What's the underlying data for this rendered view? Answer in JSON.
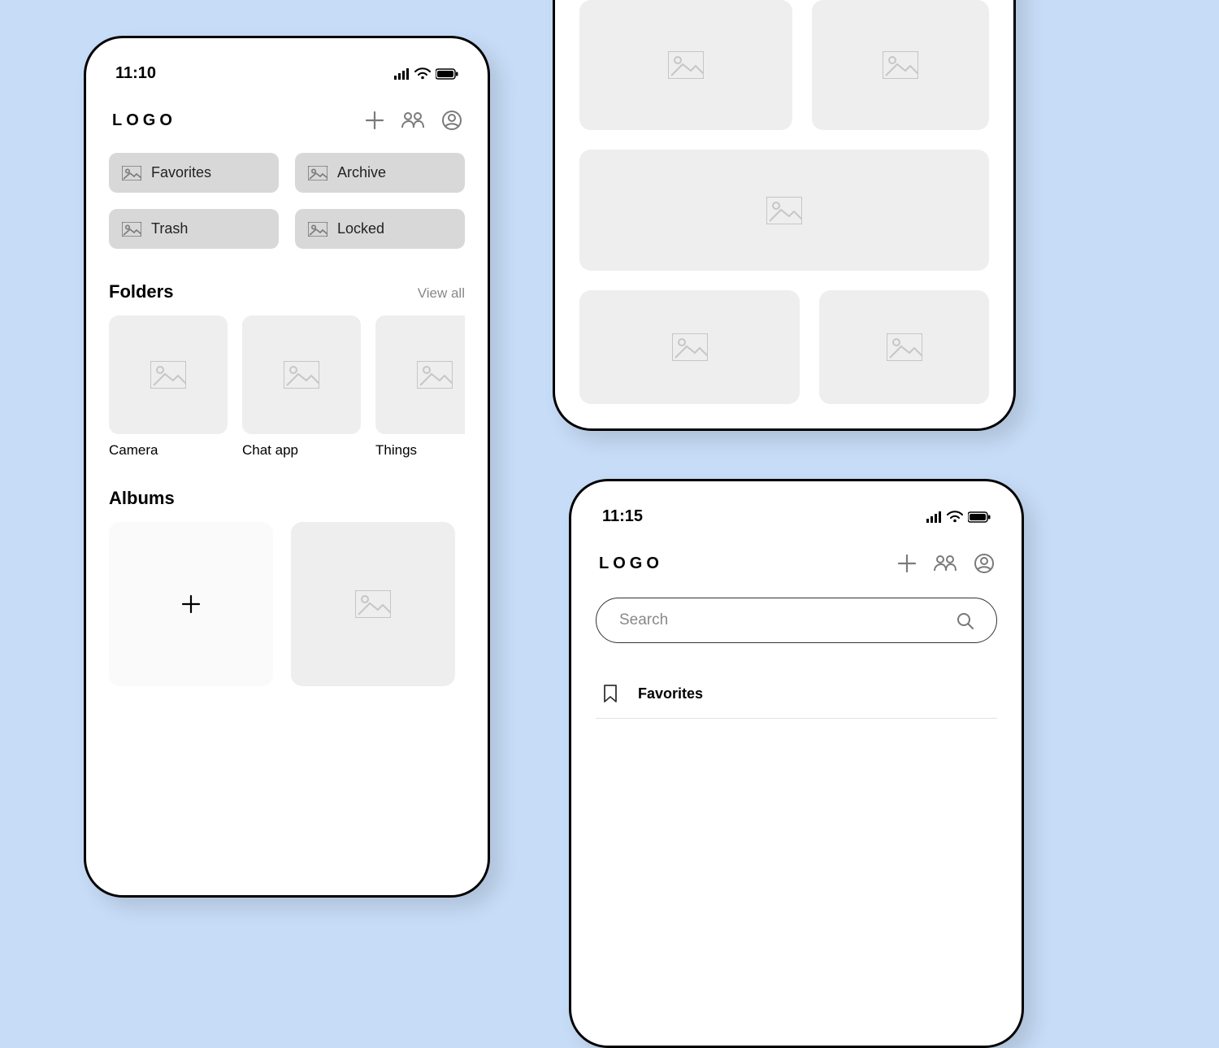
{
  "phone1": {
    "status": {
      "time": "11:10"
    },
    "header": {
      "logo": "LOGO"
    },
    "chips": [
      {
        "label": "Favorites"
      },
      {
        "label": "Archive"
      },
      {
        "label": "Trash"
      },
      {
        "label": "Locked"
      }
    ],
    "folders_section": {
      "title": "Folders",
      "view_all": "View all"
    },
    "folders": [
      {
        "label": "Camera"
      },
      {
        "label": "Chat app"
      },
      {
        "label": "Things"
      }
    ],
    "albums_section": {
      "title": "Albums"
    }
  },
  "phone3": {
    "status": {
      "time": "11:15"
    },
    "header": {
      "logo": "LOGO"
    },
    "search": {
      "placeholder": "Search"
    },
    "list": {
      "first": "Favorites"
    }
  }
}
